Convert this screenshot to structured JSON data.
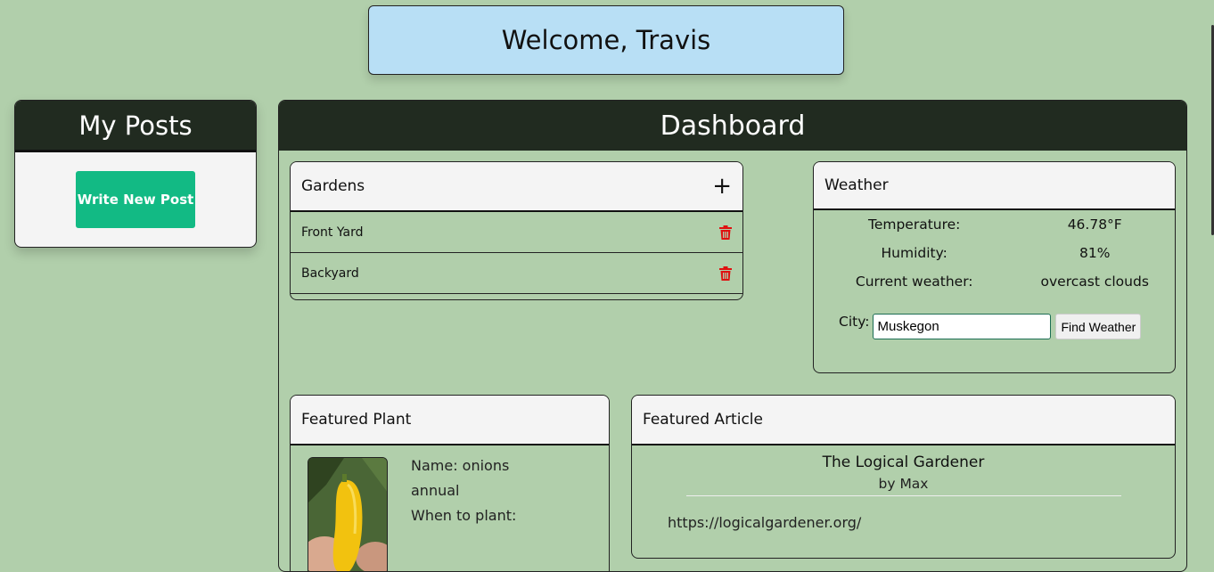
{
  "welcome": "Welcome, Travis",
  "my_posts": {
    "title": "My Posts",
    "write_label": "Write New Post"
  },
  "dashboard": {
    "title": "Dashboard",
    "gardens": {
      "title": "Gardens",
      "add_icon": "+",
      "items": [
        {
          "name": "Front Yard"
        },
        {
          "name": "Backyard"
        }
      ]
    },
    "weather": {
      "title": "Weather",
      "rows": [
        {
          "label": "Temperature:",
          "value": "46.78°F"
        },
        {
          "label": "Humidity:",
          "value": "81%"
        },
        {
          "label": "Current weather:",
          "value": "overcast clouds"
        }
      ],
      "city_label": "City:",
      "city_value": "Muskegon",
      "find_label": "Find Weather"
    },
    "featured_plant": {
      "title": "Featured Plant",
      "name_line": "Name: onions",
      "type_line": "annual",
      "when_line": "When to plant:"
    },
    "featured_article": {
      "title": "Featured Article",
      "article_title": "The Logical Gardener",
      "author": "by Max",
      "url": "https://logicalgardener.org/"
    }
  },
  "colors": {
    "background": "#b1cfab",
    "header_dark": "#212b20",
    "welcome_bg": "#b8dff5",
    "accent_green": "#12ba84",
    "delete_red": "#e01010"
  }
}
